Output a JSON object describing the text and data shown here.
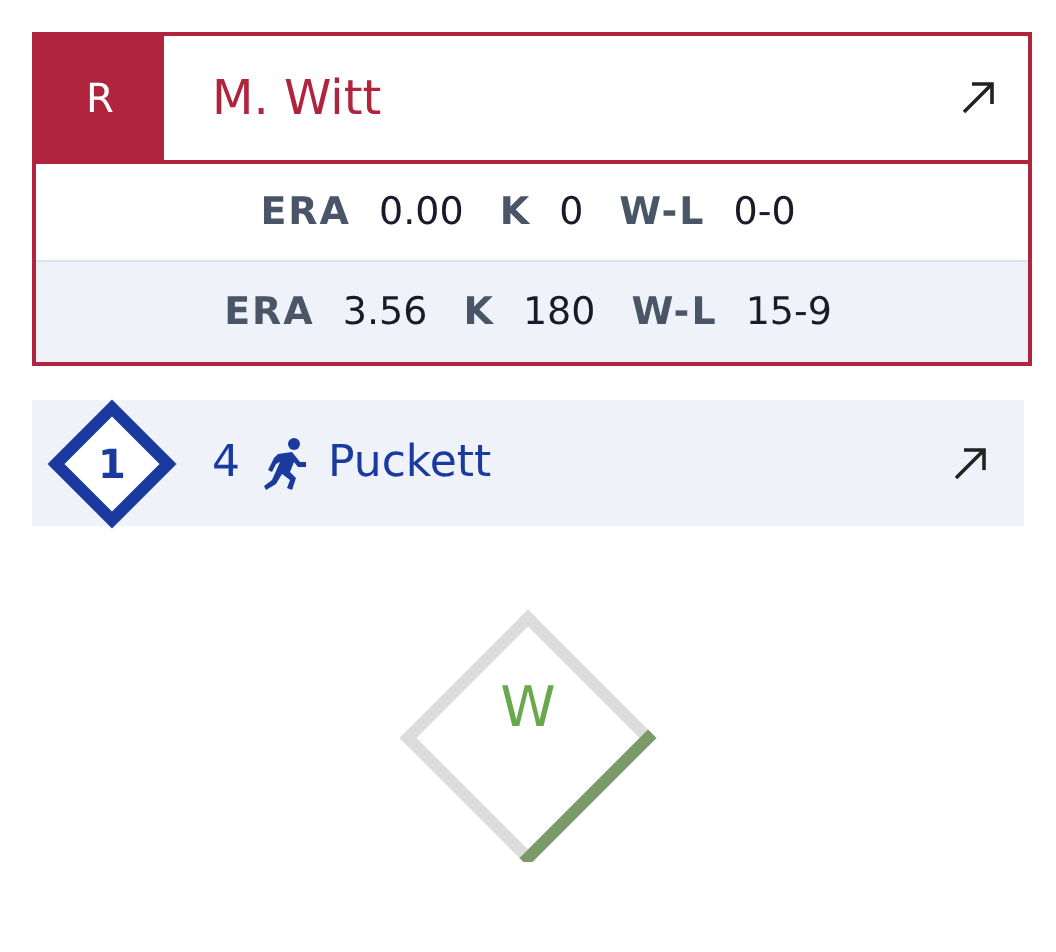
{
  "pitcher": {
    "hand": "R",
    "name": "M. Witt",
    "stat_rows": [
      {
        "kind": "game",
        "stats": [
          {
            "label": "ERA",
            "value": "0.00"
          },
          {
            "label": "K",
            "value": "0"
          },
          {
            "label": "W-L",
            "value": "0-0"
          }
        ]
      },
      {
        "kind": "season",
        "stats": [
          {
            "label": "ERA",
            "value": "3.56"
          },
          {
            "label": "K",
            "value": "180"
          },
          {
            "label": "W-L",
            "value": "15-9"
          }
        ]
      }
    ]
  },
  "runner": {
    "base": "1",
    "number": "4",
    "name": "Puckett"
  },
  "diamond": {
    "label": "W",
    "edges": [
      {
        "highlighted": true
      },
      {
        "highlighted": false
      },
      {
        "highlighted": false
      },
      {
        "highlighted": false
      }
    ]
  }
}
